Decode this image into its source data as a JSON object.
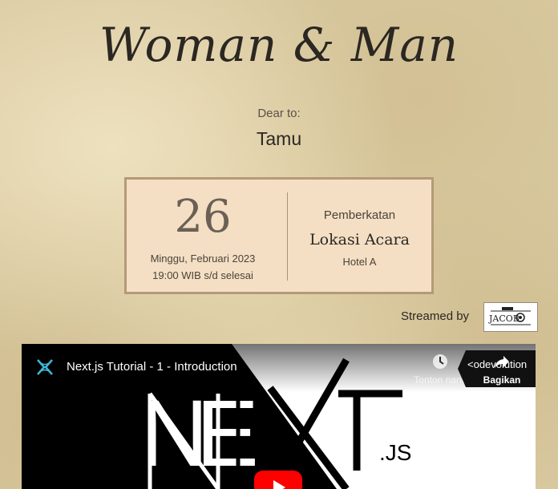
{
  "header": {
    "couple_names": "Woman & Man",
    "dear_label": "Dear to:",
    "guest_name": "Tamu"
  },
  "event": {
    "day": "26",
    "date_line": "Minggu, Februari 2023",
    "time_line": "19:00 WIB s/d selesai",
    "type": "Pemberkatan",
    "location": "Lokasi Acara",
    "venue": "Hotel A"
  },
  "stream": {
    "label": "Streamed by",
    "logo_text": "JACOB"
  },
  "video": {
    "title": "Next.js Tutorial - 1 - Introduction",
    "watch_later_label": "Tonton nanti",
    "share_label": "Bagikan",
    "watermark": "<odevolution",
    "thumbnail_text": "NEXT",
    "thumbnail_suffix": ".JS",
    "icons": [
      "channel-icon",
      "clock-icon",
      "share-arrow-icon",
      "play-icon"
    ]
  },
  "colors": {
    "paper": "#d9c9a0",
    "card": "#f4dfc4",
    "card_border": "#b49a78",
    "text_dark": "#2b2722",
    "youtube_red": "#ff0000"
  }
}
